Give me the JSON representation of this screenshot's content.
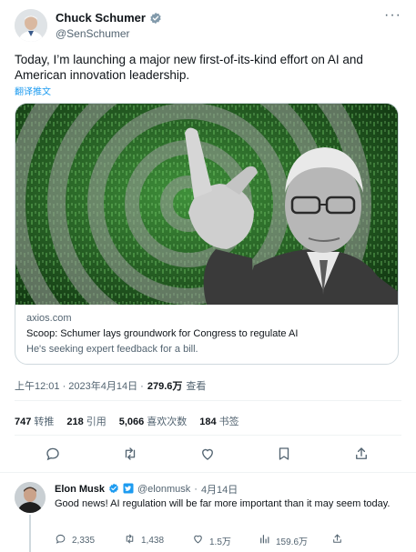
{
  "tweet": {
    "author_name": "Chuck Schumer",
    "author_handle": "@SenSchumer",
    "text": "Today, I’m launching a major new first-of-its-kind effort on AI and American innovation leadership.",
    "translate_label": "翻译推文",
    "card": {
      "domain": "axios.com",
      "title": "Scoop: Schumer lays groundwork for Congress to regulate AI",
      "description": "He's seeking expert feedback for a bill."
    },
    "timestamp": "上午12:01 · 2023年4月14日 ·",
    "views_count": "279.6万",
    "views_label": "查看",
    "stats": [
      {
        "count": "747",
        "label": "转推"
      },
      {
        "count": "218",
        "label": "引用"
      },
      {
        "count": "5,066",
        "label": "喜欢次数"
      },
      {
        "count": "184",
        "label": "书签"
      }
    ],
    "actions": [
      "reply-icon",
      "retweet-icon",
      "like-icon",
      "bookmark-icon",
      "share-icon"
    ]
  },
  "reply": {
    "author_name": "Elon Musk",
    "author_handle": "@elonmusk",
    "separator": "·",
    "date": "4月14日",
    "text": "Good news! AI regulation will be far more important than it may seem today.",
    "actions": [
      {
        "icon": "reply-icon",
        "count": "2,335"
      },
      {
        "icon": "retweet-icon",
        "count": "1,438"
      },
      {
        "icon": "like-icon",
        "count": "1.5万"
      },
      {
        "icon": "views-icon",
        "count": "159.6万"
      },
      {
        "icon": "share-icon",
        "count": ""
      }
    ]
  },
  "colors": {
    "accent": "#1d9bf0",
    "verified_gold": "#e2b719",
    "text_primary": "#0f1419",
    "text_secondary": "#536471",
    "border": "#cfd9de"
  }
}
